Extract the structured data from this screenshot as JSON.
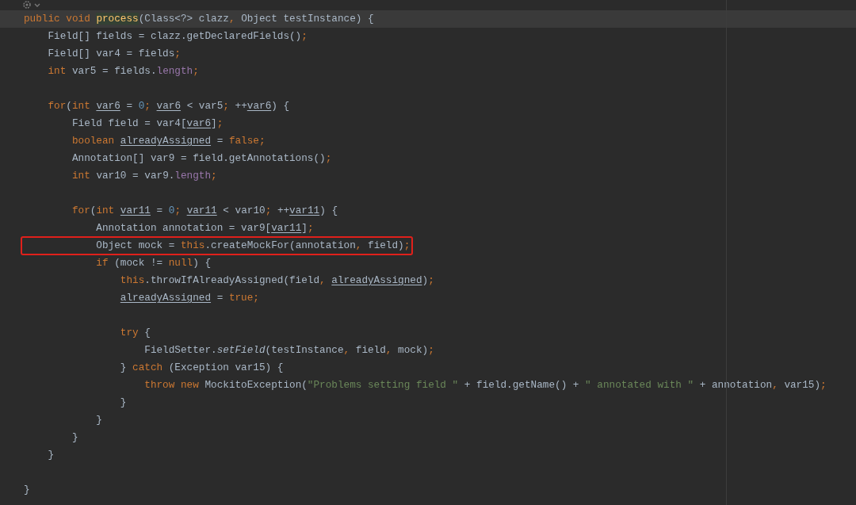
{
  "editor": {
    "lines": [
      {
        "kind": "code",
        "current": true,
        "boxed": false,
        "tokens": [
          {
            "kind": "kw",
            "text": "public void "
          },
          {
            "kind": "fn",
            "text": "process"
          },
          {
            "kind": "p",
            "text": "(Class<?> clazz"
          },
          {
            "kind": "op",
            "text": ", "
          },
          {
            "kind": "p",
            "text": "Object testInstance) {"
          }
        ]
      },
      {
        "kind": "code",
        "current": false,
        "boxed": false,
        "tokens": [
          {
            "kind": "p",
            "text": "    Field[] fields = clazz.getDeclaredFields()"
          },
          {
            "kind": "op",
            "text": ";"
          }
        ]
      },
      {
        "kind": "code",
        "current": false,
        "boxed": false,
        "tokens": [
          {
            "kind": "p",
            "text": "    Field[] var4 = fields"
          },
          {
            "kind": "op",
            "text": ";"
          }
        ]
      },
      {
        "kind": "code",
        "current": false,
        "boxed": false,
        "tokens": [
          {
            "kind": "kw",
            "text": "    int "
          },
          {
            "kind": "p",
            "text": "var5 = fields."
          },
          {
            "kind": "fld",
            "text": "length"
          },
          {
            "kind": "op",
            "text": ";"
          }
        ]
      },
      {
        "kind": "blank"
      },
      {
        "kind": "code",
        "current": false,
        "boxed": false,
        "tokens": [
          {
            "kind": "kw",
            "text": "    for"
          },
          {
            "kind": "p",
            "text": "("
          },
          {
            "kind": "kw",
            "text": "int "
          },
          {
            "kind": "var",
            "text": "var6"
          },
          {
            "kind": "p",
            "text": " = "
          },
          {
            "kind": "num",
            "text": "0"
          },
          {
            "kind": "op",
            "text": "; "
          },
          {
            "kind": "var",
            "text": "var6"
          },
          {
            "kind": "p",
            "text": " < var5"
          },
          {
            "kind": "op",
            "text": "; "
          },
          {
            "kind": "p",
            "text": "++"
          },
          {
            "kind": "var",
            "text": "var6"
          },
          {
            "kind": "p",
            "text": ") {"
          }
        ]
      },
      {
        "kind": "code",
        "current": false,
        "boxed": false,
        "tokens": [
          {
            "kind": "p",
            "text": "        Field field = var4["
          },
          {
            "kind": "var",
            "text": "var6"
          },
          {
            "kind": "p",
            "text": "]"
          },
          {
            "kind": "op",
            "text": ";"
          }
        ]
      },
      {
        "kind": "code",
        "current": false,
        "boxed": false,
        "tokens": [
          {
            "kind": "kw",
            "text": "        boolean "
          },
          {
            "kind": "var",
            "text": "alreadyAssigned"
          },
          {
            "kind": "p",
            "text": " = "
          },
          {
            "kind": "kw",
            "text": "false;"
          }
        ]
      },
      {
        "kind": "code",
        "current": false,
        "boxed": false,
        "tokens": [
          {
            "kind": "p",
            "text": "        Annotation[] var9 = field.getAnnotations()"
          },
          {
            "kind": "op",
            "text": ";"
          }
        ]
      },
      {
        "kind": "code",
        "current": false,
        "boxed": false,
        "tokens": [
          {
            "kind": "kw",
            "text": "        int "
          },
          {
            "kind": "p",
            "text": "var10 = var9."
          },
          {
            "kind": "fld",
            "text": "length"
          },
          {
            "kind": "op",
            "text": ";"
          }
        ]
      },
      {
        "kind": "blank"
      },
      {
        "kind": "code",
        "current": false,
        "boxed": false,
        "tokens": [
          {
            "kind": "kw",
            "text": "        for"
          },
          {
            "kind": "p",
            "text": "("
          },
          {
            "kind": "kw",
            "text": "int "
          },
          {
            "kind": "var",
            "text": "var11"
          },
          {
            "kind": "p",
            "text": " = "
          },
          {
            "kind": "num",
            "text": "0"
          },
          {
            "kind": "op",
            "text": "; "
          },
          {
            "kind": "var",
            "text": "var11"
          },
          {
            "kind": "p",
            "text": " < var10"
          },
          {
            "kind": "op",
            "text": "; "
          },
          {
            "kind": "p",
            "text": "++"
          },
          {
            "kind": "var",
            "text": "var11"
          },
          {
            "kind": "p",
            "text": ") {"
          }
        ]
      },
      {
        "kind": "code",
        "current": false,
        "boxed": false,
        "tokens": [
          {
            "kind": "p",
            "text": "            Annotation annotation = var9["
          },
          {
            "kind": "var",
            "text": "var11"
          },
          {
            "kind": "p",
            "text": "]"
          },
          {
            "kind": "op",
            "text": ";"
          }
        ]
      },
      {
        "kind": "code",
        "current": false,
        "boxed": true,
        "tokens": [
          {
            "kind": "p",
            "text": "            Object mock = "
          },
          {
            "kind": "kw",
            "text": "this"
          },
          {
            "kind": "p",
            "text": ".createMockFor(annotation"
          },
          {
            "kind": "op",
            "text": ", "
          },
          {
            "kind": "p",
            "text": "field)"
          },
          {
            "kind": "op",
            "text": ";"
          }
        ]
      },
      {
        "kind": "code",
        "current": false,
        "boxed": false,
        "tokens": [
          {
            "kind": "kw",
            "text": "            if "
          },
          {
            "kind": "p",
            "text": "(mock != "
          },
          {
            "kind": "kw",
            "text": "null"
          },
          {
            "kind": "p",
            "text": ") {"
          }
        ]
      },
      {
        "kind": "code",
        "current": false,
        "boxed": false,
        "tokens": [
          {
            "kind": "kw",
            "text": "                this"
          },
          {
            "kind": "p",
            "text": ".throwIfAlreadyAssigned(field"
          },
          {
            "kind": "op",
            "text": ", "
          },
          {
            "kind": "var",
            "text": "alreadyAssigned"
          },
          {
            "kind": "p",
            "text": ")"
          },
          {
            "kind": "op",
            "text": ";"
          }
        ]
      },
      {
        "kind": "code",
        "current": false,
        "boxed": false,
        "tokens": [
          {
            "kind": "var",
            "text": "                alreadyAssigned"
          },
          {
            "kind": "p",
            "text": " = "
          },
          {
            "kind": "kw",
            "text": "true;"
          }
        ]
      },
      {
        "kind": "blank"
      },
      {
        "kind": "code",
        "current": false,
        "boxed": false,
        "tokens": [
          {
            "kind": "kw",
            "text": "                try "
          },
          {
            "kind": "p",
            "text": "{"
          }
        ]
      },
      {
        "kind": "code",
        "current": false,
        "boxed": false,
        "tokens": [
          {
            "kind": "p",
            "text": "                    FieldSetter."
          },
          {
            "kind": "it",
            "text": "setField"
          },
          {
            "kind": "p",
            "text": "(testInstance"
          },
          {
            "kind": "op",
            "text": ", "
          },
          {
            "kind": "p",
            "text": "field"
          },
          {
            "kind": "op",
            "text": ", "
          },
          {
            "kind": "p",
            "text": "mock)"
          },
          {
            "kind": "op",
            "text": ";"
          }
        ]
      },
      {
        "kind": "code",
        "current": false,
        "boxed": false,
        "tokens": [
          {
            "kind": "p",
            "text": "                } "
          },
          {
            "kind": "kw",
            "text": "catch "
          },
          {
            "kind": "p",
            "text": "(Exception var15) {"
          }
        ]
      },
      {
        "kind": "code",
        "current": false,
        "boxed": false,
        "tokens": [
          {
            "kind": "kw",
            "text": "                    throw new "
          },
          {
            "kind": "p",
            "text": "MockitoException("
          },
          {
            "kind": "str",
            "text": "\"Problems setting field \""
          },
          {
            "kind": "p",
            "text": " + field.getName() + "
          },
          {
            "kind": "str",
            "text": "\" annotated with \""
          },
          {
            "kind": "p",
            "text": " + annotation"
          },
          {
            "kind": "op",
            "text": ", "
          },
          {
            "kind": "p",
            "text": "var15)"
          },
          {
            "kind": "op",
            "text": ";"
          }
        ]
      },
      {
        "kind": "code",
        "current": false,
        "boxed": false,
        "tokens": [
          {
            "kind": "p",
            "text": "                }"
          }
        ]
      },
      {
        "kind": "code",
        "current": false,
        "boxed": false,
        "tokens": [
          {
            "kind": "p",
            "text": "            }"
          }
        ]
      },
      {
        "kind": "code",
        "current": false,
        "boxed": false,
        "tokens": [
          {
            "kind": "p",
            "text": "        }"
          }
        ]
      },
      {
        "kind": "code",
        "current": false,
        "boxed": false,
        "tokens": [
          {
            "kind": "p",
            "text": "    }"
          }
        ]
      },
      {
        "kind": "blank"
      },
      {
        "kind": "code",
        "current": false,
        "boxed": false,
        "tokens": [
          {
            "kind": "p",
            "text": "}"
          }
        ]
      }
    ]
  }
}
